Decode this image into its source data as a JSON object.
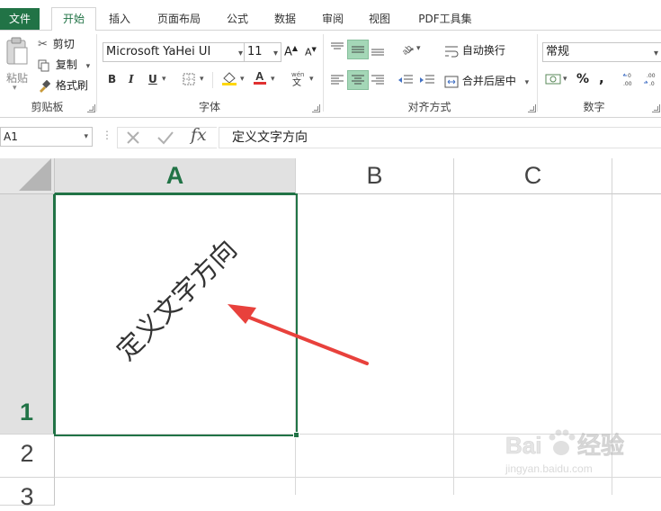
{
  "tabs": {
    "file": "文件",
    "home": "开始",
    "insert": "插入",
    "page_layout": "页面布局",
    "formulas": "公式",
    "data": "数据",
    "review": "审阅",
    "view": "视图",
    "pdf": "PDF工具集"
  },
  "clipboard": {
    "paste": "粘贴",
    "cut": "剪切",
    "copy": "复制",
    "format_painter": "格式刷",
    "group_label": "剪贴板"
  },
  "font": {
    "name": "Microsoft YaHei UI",
    "size": "11",
    "bold": "B",
    "italic": "I",
    "underline": "U",
    "group_label": "字体",
    "font_color": "#e03030",
    "fill_color": "#ffd700"
  },
  "alignment": {
    "wrap_text": "自动换行",
    "merge_center": "合并后居中",
    "group_label": "对齐方式"
  },
  "number": {
    "format": "常规",
    "percent": "%",
    "comma": ",",
    "group_label": "数字"
  },
  "formula_bar": {
    "name_box": "A1",
    "fx": "fx",
    "content": "定义文字方向"
  },
  "grid": {
    "columns": [
      "A",
      "B",
      "C"
    ],
    "rows": [
      "1",
      "2",
      "3"
    ],
    "selected_cell": "A1",
    "cell_a1_text": "定义文字方向",
    "cell_a1_rotation_deg": -45
  },
  "colors": {
    "accent": "#217346",
    "arrow": "#e8413c"
  },
  "watermark": {
    "brand": "Baidu经验",
    "url": "jingyan.baidu.com"
  }
}
